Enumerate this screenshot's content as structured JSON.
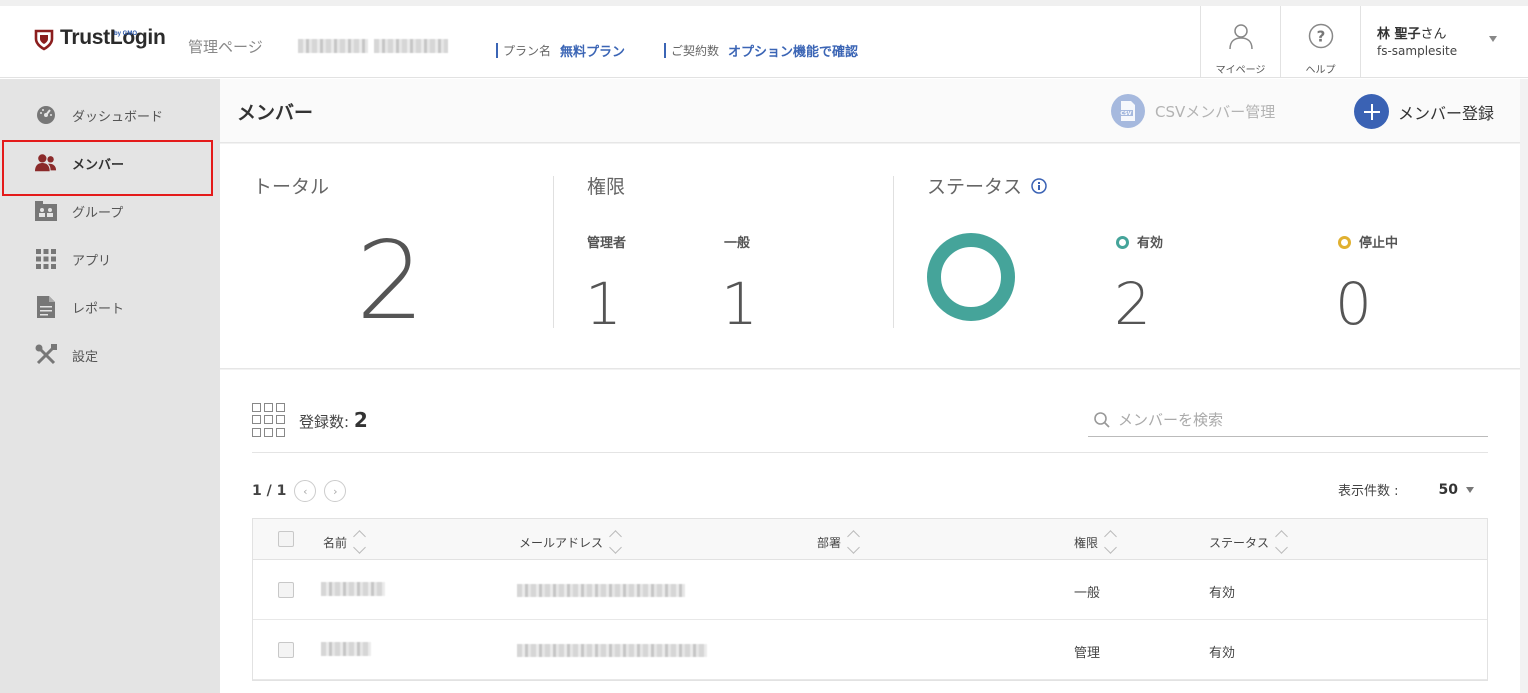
{
  "header": {
    "logo": "TrustLogin",
    "logo_sub": "by GMO",
    "admin_label": "管理ページ",
    "plan_label": "プラン名",
    "plan_value": "無料プラン",
    "contract_label": "ご契約数",
    "contract_value": "オプション機能で確認",
    "mypage_label": "マイページ",
    "help_label": "ヘルプ",
    "user_name": "林 聖子",
    "user_suffix": "さん",
    "user_site": "fs-samplesite"
  },
  "sidebar": {
    "items": [
      {
        "label": "ダッシュボード",
        "icon": "dashboard-icon"
      },
      {
        "label": "メンバー",
        "icon": "members-icon"
      },
      {
        "label": "グループ",
        "icon": "group-icon"
      },
      {
        "label": "アプリ",
        "icon": "apps-grid-icon"
      },
      {
        "label": "レポート",
        "icon": "report-icon"
      },
      {
        "label": "設定",
        "icon": "tools-icon"
      }
    ]
  },
  "main": {
    "title": "メンバー",
    "csv_button": "CSVメンバー管理",
    "add_button": "メンバー登録",
    "stats": {
      "total_title": "トータル",
      "total_value": "2",
      "role_title": "権限",
      "admin_label": "管理者",
      "admin_value": "1",
      "general_label": "一般",
      "general_value": "1",
      "status_title": "ステータス",
      "active_label": "有効",
      "active_value": "2",
      "suspended_label": "停止中",
      "suspended_value": "0"
    },
    "list": {
      "count_label": "登録数:",
      "count_value": "2",
      "search_placeholder": "メンバーを検索",
      "pager": "1 / 1",
      "per_page_label": "表示件数 :",
      "per_page_value": "50",
      "columns": [
        "名前",
        "メールアドレス",
        "部署",
        "権限",
        "ステータス"
      ],
      "rows": [
        {
          "role": "一般",
          "status": "有効"
        },
        {
          "role": "管理",
          "status": "有効"
        }
      ]
    }
  },
  "colors": {
    "accent": "#3a62b4",
    "active_member": "#8b2a2a",
    "status_active": "#45a49a",
    "status_suspended": "#e0b030",
    "highlight": "#e41a1a"
  }
}
